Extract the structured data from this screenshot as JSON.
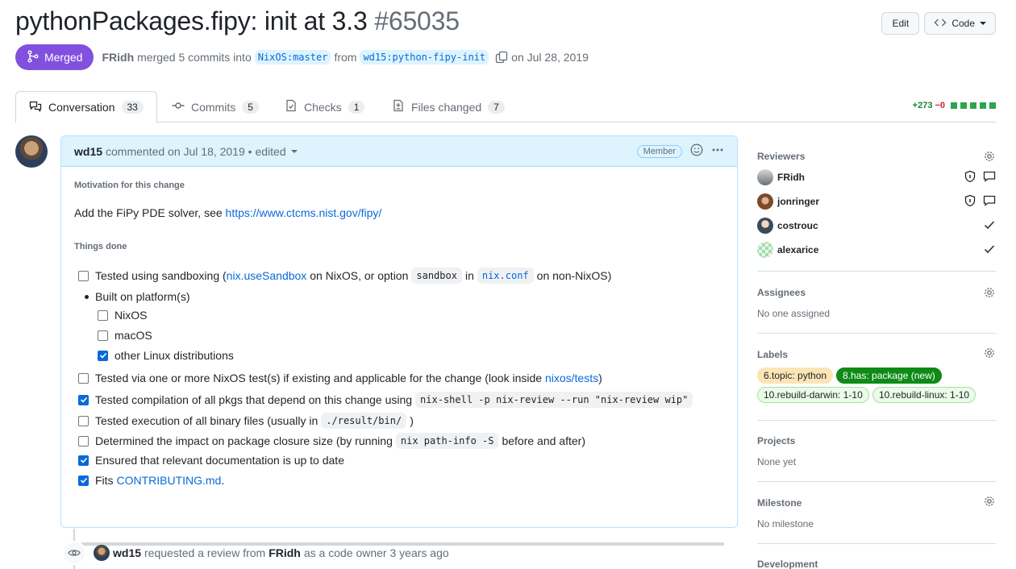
{
  "header": {
    "title": "pythonPackages.fipy: init at 3.3",
    "number": "#65035",
    "edit_label": "Edit",
    "code_label": "Code"
  },
  "meta": {
    "state": "Merged",
    "author": "FRidh",
    "action": "merged 5 commits into",
    "base_branch": "NixOS:master",
    "from": "from",
    "head_branch": "wd15:python-fipy-init",
    "date": "on Jul 28, 2019"
  },
  "tabs": [
    {
      "label": "Conversation",
      "count": "33"
    },
    {
      "label": "Commits",
      "count": "5"
    },
    {
      "label": "Checks",
      "count": "1"
    },
    {
      "label": "Files changed",
      "count": "7"
    }
  ],
  "diffstat": {
    "additions": "+273",
    "deletions": "−0"
  },
  "comment": {
    "author": "wd15",
    "action": "commented on Jul 18, 2019 • edited",
    "role": "Member",
    "motivation_heading": "Motivation for this change",
    "motivation_text": "Add the FiPy PDE solver, see",
    "motivation_link": "https://www.ctcms.nist.gov/fipy/",
    "things_done_heading": "Things done",
    "tasks": {
      "sandbox_pre": "Tested using sandboxing (",
      "sandbox_link": "nix.useSandbox",
      "sandbox_mid": "on NixOS, or option",
      "sandbox_code": "sandbox",
      "sandbox_in": "in",
      "sandbox_conf": "nix.conf",
      "sandbox_post": "on non-NixOS)",
      "built_on": "Built on platform(s)",
      "nixos": "NixOS",
      "macos": "macOS",
      "other_linux": "other Linux distributions",
      "tests_pre": "Tested via one or more NixOS test(s) if existing and applicable for the change (look inside",
      "tests_link": "nixos/tests",
      "tests_post": ")",
      "compile_pre": "Tested compilation of all pkgs that depend on this change using",
      "compile_code": "nix-shell -p nix-review --run \"nix-review wip\"",
      "exec_pre": "Tested execution of all binary files (usually in",
      "exec_code": "./result/bin/",
      "exec_post": ")",
      "closure_pre": "Determined the impact on package closure size (by running",
      "closure_code": "nix path-info -S",
      "closure_post": "before and after)",
      "docs": "Ensured that relevant documentation is up to date",
      "fits_pre": "Fits",
      "fits_link": "CONTRIBUTING.md",
      "fits_post": "."
    }
  },
  "event": {
    "actor": "wd15",
    "text1": "requested a review from",
    "target": "FRidh",
    "text2": "as a code owner 3 years ago"
  },
  "sidebar": {
    "reviewers_title": "Reviewers",
    "reviewers": [
      {
        "name": "FRidh"
      },
      {
        "name": "jonringer"
      },
      {
        "name": "costrouc"
      },
      {
        "name": "alexarice"
      }
    ],
    "assignees_title": "Assignees",
    "assignees_text": "No one assigned",
    "labels_title": "Labels",
    "labels": [
      {
        "name": "6.topic: python",
        "bg": "#fbe5b6",
        "fg": "#1f2328",
        "border": "#fbe5b6"
      },
      {
        "name": "8.has: package (new)",
        "bg": "#0e8a16",
        "fg": "#ffffff",
        "border": "#0e8a16"
      },
      {
        "name": "10.rebuild-darwin: 1-10",
        "bg": "#eafbe7",
        "fg": "#1f2328",
        "border": "#a6e0a0"
      },
      {
        "name": "10.rebuild-linux: 1-10",
        "bg": "#eafbe7",
        "fg": "#1f2328",
        "border": "#a6e0a0"
      }
    ],
    "projects_title": "Projects",
    "projects_text": "None yet",
    "milestone_title": "Milestone",
    "milestone_text": "No milestone",
    "development_title": "Development"
  }
}
